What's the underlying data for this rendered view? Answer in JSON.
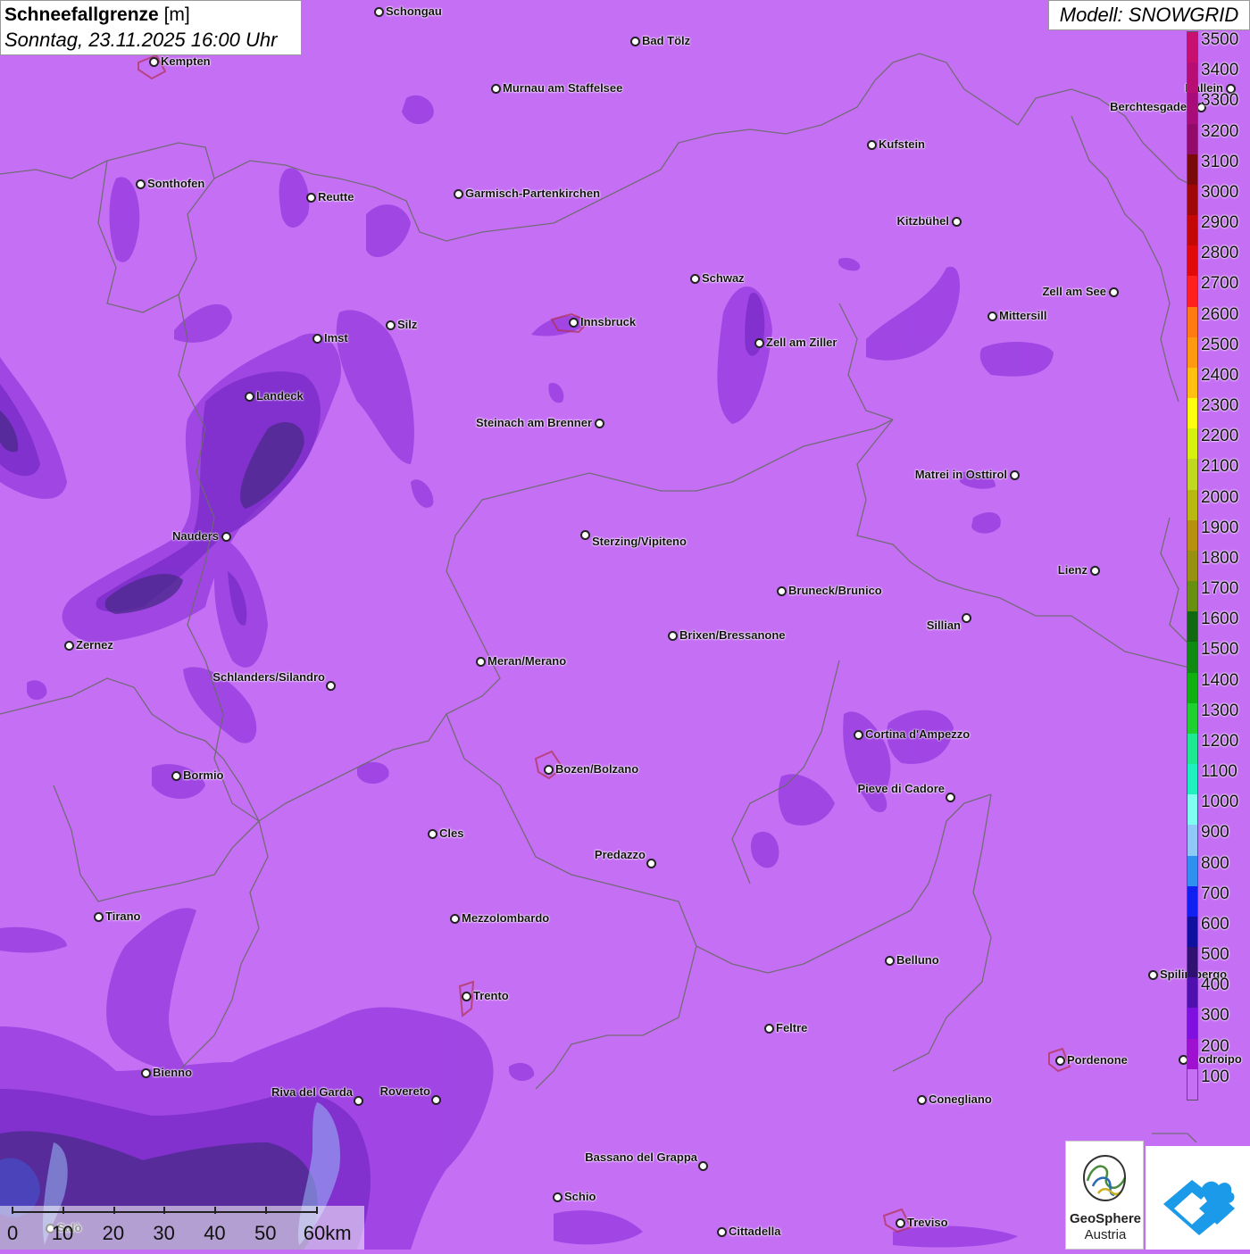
{
  "header": {
    "title_bold": "Schneefallgrenze",
    "title_unit": "[m]",
    "datetime": "Sonntag, 23.11.2025 16:00 Uhr",
    "model": "Modell: SNOWGRID"
  },
  "colors": {
    "background": "#c56ff5",
    "low_snowline": "#9a3fe0",
    "lower_snowline": "#7a2cc8",
    "lowest_snowline": "#4a2a8a",
    "border": "#6a6a6a"
  },
  "legend": {
    "unit": "m",
    "classes": [
      {
        "label": "3500",
        "color": "#c8106e"
      },
      {
        "label": "3400",
        "color": "#b80e74"
      },
      {
        "label": "3300",
        "color": "#a80c78"
      },
      {
        "label": "3200",
        "color": "#920a6a"
      },
      {
        "label": "3100",
        "color": "#7a0a0a"
      },
      {
        "label": "3000",
        "color": "#a00808"
      },
      {
        "label": "2900",
        "color": "#c40808"
      },
      {
        "label": "2800",
        "color": "#e00a0a"
      },
      {
        "label": "2700",
        "color": "#ff2020"
      },
      {
        "label": "2600",
        "color": "#ff7a10"
      },
      {
        "label": "2500",
        "color": "#ff9a10"
      },
      {
        "label": "2400",
        "color": "#ffc010"
      },
      {
        "label": "2300",
        "color": "#ffff10"
      },
      {
        "label": "2200",
        "color": "#d8f010"
      },
      {
        "label": "2100",
        "color": "#c0d820"
      },
      {
        "label": "2000",
        "color": "#b8b810"
      },
      {
        "label": "1900",
        "color": "#b89010"
      },
      {
        "label": "1800",
        "color": "#989010"
      },
      {
        "label": "1700",
        "color": "#689010"
      },
      {
        "label": "1600",
        "color": "#106810"
      },
      {
        "label": "1500",
        "color": "#108a10"
      },
      {
        "label": "1400",
        "color": "#10b010"
      },
      {
        "label": "1300",
        "color": "#20d030"
      },
      {
        "label": "1200",
        "color": "#20e890"
      },
      {
        "label": "1100",
        "color": "#20f0c0"
      },
      {
        "label": "1000",
        "color": "#80fff0"
      },
      {
        "label": "900",
        "color": "#90c8f8"
      },
      {
        "label": "800",
        "color": "#3090f0"
      },
      {
        "label": "700",
        "color": "#1020f0"
      },
      {
        "label": "600",
        "color": "#1010a0"
      },
      {
        "label": "500",
        "color": "#301070"
      },
      {
        "label": "400",
        "color": "#5010b0"
      },
      {
        "label": "300",
        "color": "#8010e0"
      },
      {
        "label": "200",
        "color": "#a010d0"
      },
      {
        "label": "100",
        "color": "#c56ff5"
      }
    ]
  },
  "cities": [
    {
      "name": "Schongau"
    },
    {
      "name": "Bad Tölz"
    },
    {
      "name": "Kempten"
    },
    {
      "name": "Murnau am Staffelsee"
    },
    {
      "name": "Hallein"
    },
    {
      "name": "Berchtesgaden"
    },
    {
      "name": "Kufstein"
    },
    {
      "name": "Sonthofen"
    },
    {
      "name": "Reutte"
    },
    {
      "name": "Garmisch-Partenkirchen"
    },
    {
      "name": "Kitzbühel"
    },
    {
      "name": "Schwaz"
    },
    {
      "name": "Zell am See"
    },
    {
      "name": "Imst"
    },
    {
      "name": "Silz"
    },
    {
      "name": "Innsbruck"
    },
    {
      "name": "Mittersill"
    },
    {
      "name": "Zell am Ziller"
    },
    {
      "name": "Landeck"
    },
    {
      "name": "Steinach am Brenner"
    },
    {
      "name": "Matrei in Osttirol"
    },
    {
      "name": "Nauders"
    },
    {
      "name": "Sterzing/Vipiteno"
    },
    {
      "name": "Lienz"
    },
    {
      "name": "Bruneck/Brunico"
    },
    {
      "name": "Sillian"
    },
    {
      "name": "Brixen/Bressanone"
    },
    {
      "name": "Zernez"
    },
    {
      "name": "Meran/Merano"
    },
    {
      "name": "Schlanders/Silandro"
    },
    {
      "name": "Cortina d'Ampezzo"
    },
    {
      "name": "Bozen/Bolzano"
    },
    {
      "name": "Bormio"
    },
    {
      "name": "Pieve di Cadore"
    },
    {
      "name": "Cles"
    },
    {
      "name": "Predazzo"
    },
    {
      "name": "Tirano"
    },
    {
      "name": "Mezzolombardo"
    },
    {
      "name": "Belluno"
    },
    {
      "name": "Spilimbergo"
    },
    {
      "name": "Trento"
    },
    {
      "name": "Feltre"
    },
    {
      "name": "Pordenone"
    },
    {
      "name": "Codroipo"
    },
    {
      "name": "Bienno"
    },
    {
      "name": "Riva del Garda"
    },
    {
      "name": "Rovereto"
    },
    {
      "name": "Conegliano"
    },
    {
      "name": "Bassano del Grappa"
    },
    {
      "name": "Schio"
    },
    {
      "name": "Salò"
    },
    {
      "name": "Treviso"
    },
    {
      "name": "Cittadella"
    }
  ],
  "scale": {
    "labels": [
      "0",
      "10",
      "20",
      "30",
      "40",
      "50",
      "60km"
    ]
  },
  "logos": {
    "geosphere_line1": "GeoSphere",
    "geosphere_line2": "Austria"
  }
}
